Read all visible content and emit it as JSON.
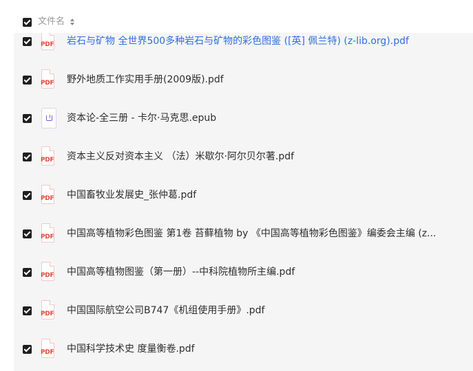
{
  "header": {
    "column_label": "文件名"
  },
  "files": [
    {
      "name": "岩石与矿物 全世界500多种岩石与矿物的彩色图鉴 ([英] 佩兰特) (z-lib.org).pdf",
      "type": "pdf",
      "checked": true,
      "highlighted": true
    },
    {
      "name": "野外地质工作实用手册(2009版).pdf",
      "type": "pdf",
      "checked": true
    },
    {
      "name": "资本论-全三册 - 卡尔·马克思.epub",
      "type": "epub",
      "checked": true
    },
    {
      "name": "资本主义反对资本主义 （法）米歇尔·阿尔贝尔著.pdf",
      "type": "pdf",
      "checked": true
    },
    {
      "name": "中国畜牧业发展史_张仲葛.pdf",
      "type": "pdf",
      "checked": true
    },
    {
      "name": "中国高等植物彩色图鉴 第1卷 苔藓植物 by 《中国高等植物彩色图鉴》编委会主编 (z...",
      "type": "pdf",
      "checked": true
    },
    {
      "name": "中国高等植物图鉴（第一册）--中科院植物所主编.pdf",
      "type": "pdf",
      "checked": true
    },
    {
      "name": "中国国际航空公司B747《机组使用手册》.pdf",
      "type": "pdf",
      "checked": true
    },
    {
      "name": "中国科学技术史 度量衡卷.pdf",
      "type": "pdf",
      "checked": true
    }
  ],
  "icons": {
    "pdf_label": "PDF",
    "pdf_color": "#e0483b",
    "epub_color": "#7b5ad6"
  },
  "colors": {
    "link": "#2f6fe0",
    "checkbox": "#1f1f1f",
    "row_bg": "#f5f5f5"
  }
}
